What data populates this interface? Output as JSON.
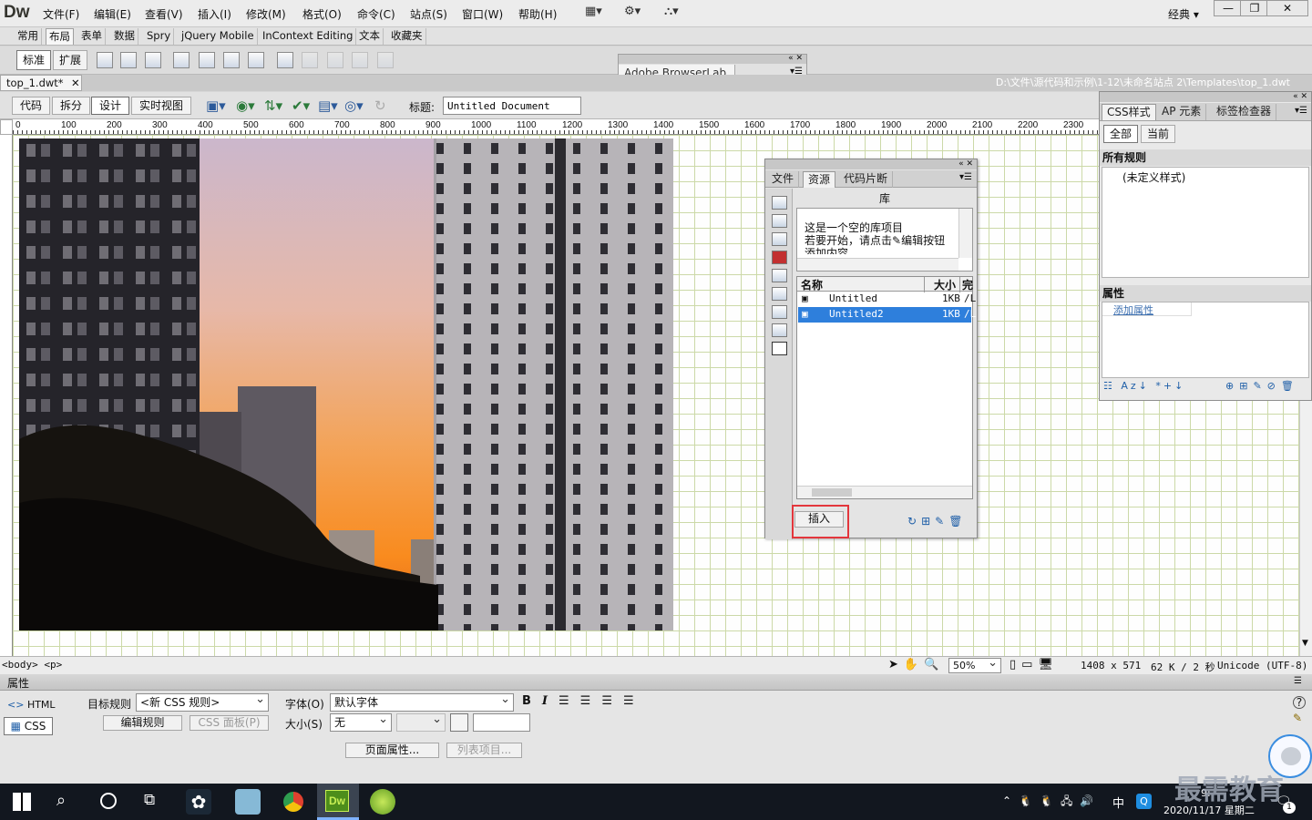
{
  "app": {
    "logo": "Dw",
    "layout_mode": "经典",
    "window_controls": [
      "—",
      "❐",
      "✕"
    ]
  },
  "menu": [
    "文件(F)",
    "编辑(E)",
    "查看(V)",
    "插入(I)",
    "修改(M)",
    "格式(O)",
    "命令(C)",
    "站点(S)",
    "窗口(W)",
    "帮助(H)"
  ],
  "insert_bar": {
    "tabs": [
      "常用",
      "布局",
      "表单",
      "数据",
      "Spry",
      "jQuery Mobile",
      "InContext Editing",
      "文本",
      "收藏夹"
    ],
    "active_tab": "布局",
    "mode_buttons": [
      "标准",
      "扩展"
    ]
  },
  "browserlab": {
    "title": "Adobe BrowserLab"
  },
  "document": {
    "tab": "top_1.dwt*",
    "path": "D:\\文件\\源代码和示例\\1-12\\未命名站点 2\\Templates\\top_1.dwt",
    "view_buttons": [
      "代码",
      "拆分",
      "设计",
      "实时视图"
    ],
    "active_view": "设计",
    "title_label": "标题:",
    "title_value": "Untitled Document"
  },
  "ruler_ticks": [
    "0",
    "100",
    "200",
    "300",
    "400",
    "500",
    "600",
    "700",
    "800",
    "900",
    "1000",
    "1100",
    "1200",
    "1300",
    "1400",
    "1500",
    "1600",
    "1700",
    "1800",
    "1900",
    "2000",
    "2100",
    "2200",
    "2300"
  ],
  "assets_panel": {
    "tabs": [
      "文件",
      "资源",
      "代码片断"
    ],
    "active_tab": "资源",
    "section_title": "库",
    "preview_lines": [
      "这是一个空的库项目",
      "若要开始，请点击",
      "编辑按钮",
      "添加内容"
    ],
    "columns": [
      "名称",
      "大小",
      "完"
    ],
    "items": [
      {
        "name": "Untitled",
        "size": "1KB",
        "path": "/L"
      },
      {
        "name": "Untitled2",
        "size": "1KB",
        "path": "/L"
      }
    ],
    "selected_item": "Untitled2",
    "insert_button": "插入",
    "highlight_color": "#e3363c"
  },
  "css_panel": {
    "tabs": [
      "CSS样式",
      "AP 元素",
      "标签检查器"
    ],
    "active_tab": "CSS样式",
    "mode_buttons": [
      "全部",
      "当前"
    ],
    "rules_title": "所有规则",
    "rules": [
      "(未定义样式)"
    ],
    "props_title": "属性",
    "add_prop": "添加属性"
  },
  "status_bar": {
    "tag_path": "<body> <p>",
    "zoom": "50%",
    "dimensions": "1408 x 571",
    "size_time": "62 K / 2 秒",
    "encoding": "Unicode (UTF-8)"
  },
  "properties": {
    "title": "属性",
    "html_btn": "HTML",
    "css_btn": "CSS",
    "target_rule_label": "目标规则",
    "target_rule_value": "<新 CSS 规则>",
    "edit_rule_btn": "编辑规则",
    "css_panel_btn": "CSS 面板(P)",
    "font_label": "字体(O)",
    "font_value": "默认字体",
    "size_label": "大小(S)",
    "size_value": "无",
    "page_props_btn": "页面属性...",
    "list_item_btn": "列表项目..."
  },
  "taskbar": {
    "ime": "中",
    "time": "9:",
    "date": "2020/11/17 星期二",
    "notification_count": "1",
    "watermark": "最需教育"
  }
}
